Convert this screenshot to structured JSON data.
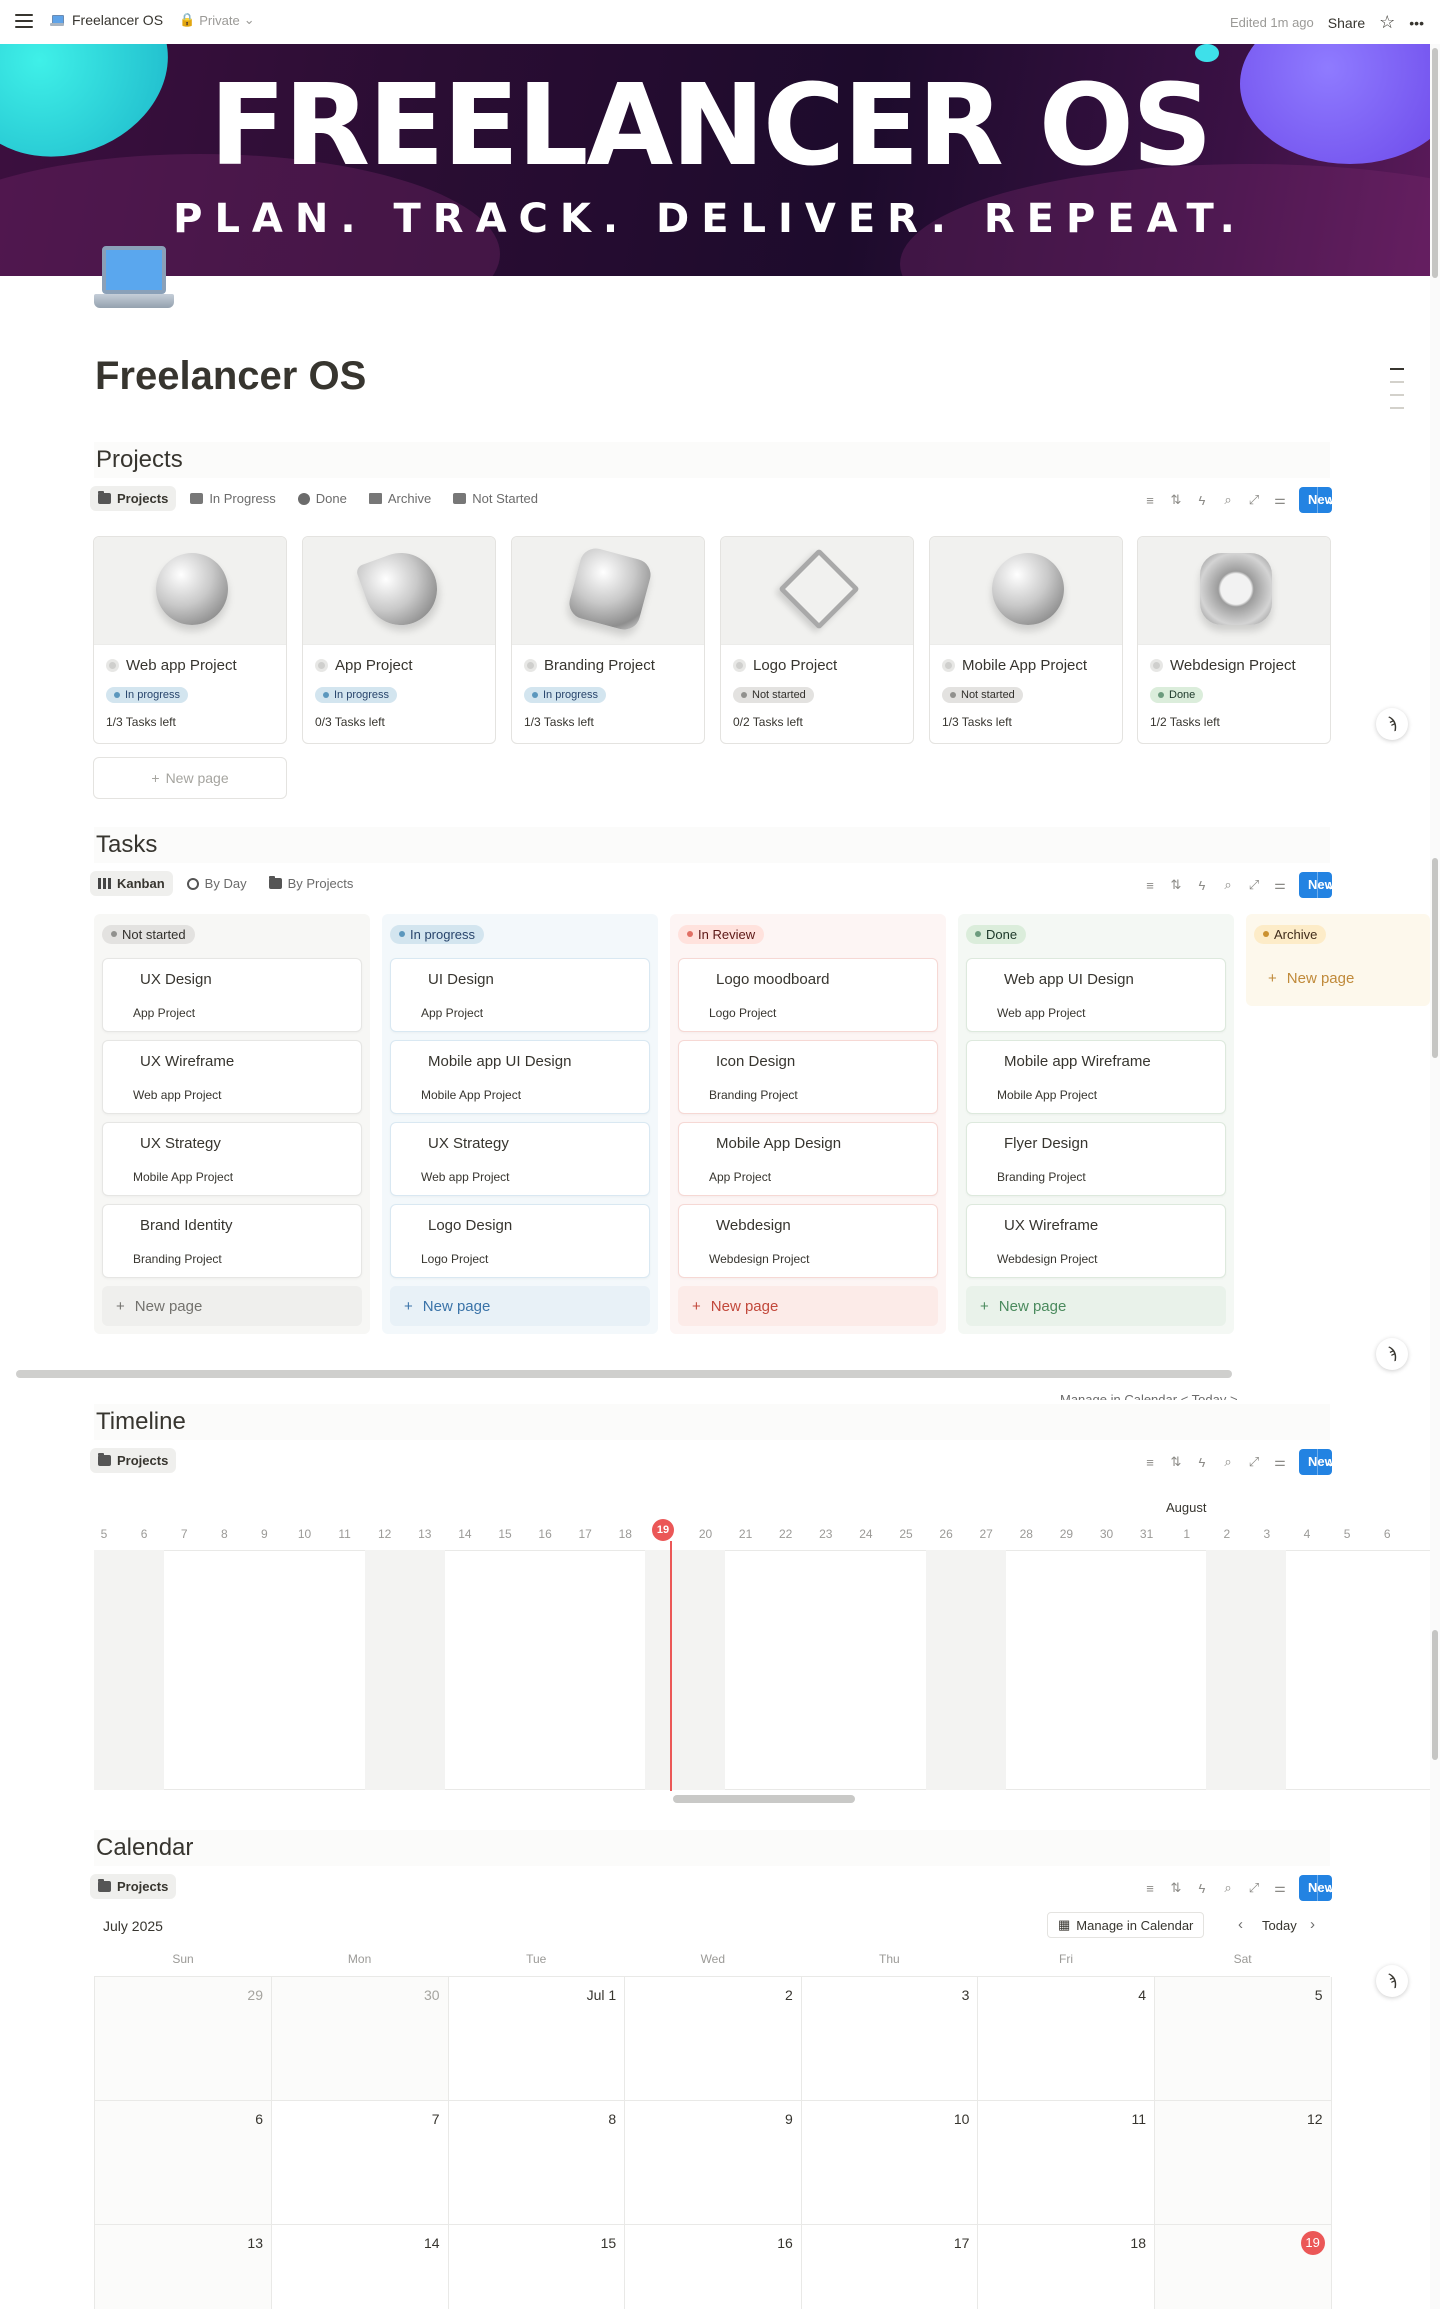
{
  "topbar": {
    "page_name": "Freelancer OS",
    "privacy": "Private",
    "edited": "Edited 1m ago",
    "share": "Share",
    "more": "•••"
  },
  "banner": {
    "title": "FREELANCER OS",
    "tagline": "PLAN. TRACK. DELIVER. REPEAT."
  },
  "page": {
    "title": "Freelancer OS"
  },
  "common": {
    "new": "New",
    "new_page": "New page",
    "plus": "+"
  },
  "projects": {
    "heading": "Projects",
    "tabs": [
      "Projects",
      "In Progress",
      "Done",
      "Archive",
      "Not Started"
    ],
    "cards": [
      {
        "name": "Web app Project",
        "status": "In progress",
        "tasks": "1/3 Tasks left"
      },
      {
        "name": "App Project",
        "status": "In progress",
        "tasks": "0/3 Tasks left"
      },
      {
        "name": "Branding Project",
        "status": "In progress",
        "tasks": "1/3 Tasks left"
      },
      {
        "name": "Logo Project",
        "status": "Not started",
        "tasks": "0/2 Tasks left"
      },
      {
        "name": "Mobile App Project",
        "status": "Not started",
        "tasks": "1/3 Tasks left"
      },
      {
        "name": "Webdesign Project",
        "status": "Done",
        "tasks": "1/2 Tasks left"
      }
    ]
  },
  "tasks": {
    "heading": "Tasks",
    "tabs": [
      "Kanban",
      "By Day",
      "By Projects"
    ],
    "columns": [
      {
        "name": "Not started",
        "cards": [
          {
            "title": "UX Design",
            "project": "App Project"
          },
          {
            "title": "UX Wireframe",
            "project": "Web app Project"
          },
          {
            "title": "UX Strategy",
            "project": "Mobile App Project"
          },
          {
            "title": "Brand Identity",
            "project": "Branding Project"
          }
        ]
      },
      {
        "name": "In progress",
        "cards": [
          {
            "title": "UI Design",
            "project": "App Project"
          },
          {
            "title": "Mobile app UI Design",
            "project": "Mobile App Project"
          },
          {
            "title": "UX Strategy",
            "project": "Web app Project"
          },
          {
            "title": "Logo Design",
            "project": "Logo Project"
          }
        ]
      },
      {
        "name": "In Review",
        "cards": [
          {
            "title": "Logo moodboard",
            "project": "Logo Project"
          },
          {
            "title": "Icon Design",
            "project": "Branding Project"
          },
          {
            "title": "Mobile App Design",
            "project": "App Project"
          },
          {
            "title": "Webdesign",
            "project": "Webdesign Project"
          }
        ]
      },
      {
        "name": "Done",
        "cards": [
          {
            "title": "Web app UI Design",
            "project": "Web app Project"
          },
          {
            "title": "Mobile app Wireframe",
            "project": "Mobile App Project"
          },
          {
            "title": "Flyer Design",
            "project": "Branding Project"
          },
          {
            "title": "UX Wireframe",
            "project": "Webdesign Project"
          }
        ]
      },
      {
        "name": "Archive",
        "cards": []
      }
    ]
  },
  "timeline": {
    "heading": "Timeline",
    "tab": "Projects",
    "month": "August",
    "days": [
      "5",
      "6",
      "7",
      "8",
      "9",
      "10",
      "11",
      "12",
      "13",
      "14",
      "15",
      "16",
      "17",
      "18",
      "19",
      "20",
      "21",
      "22",
      "23",
      "24",
      "25",
      "26",
      "27",
      "28",
      "29",
      "30",
      "31",
      "1",
      "2",
      "3",
      "4",
      "5",
      "6"
    ],
    "today": "19",
    "peek": "Manage in Calendar  < Today >"
  },
  "calendar": {
    "heading": "Calendar",
    "tab": "Projects",
    "month": "July 2025",
    "manage": "Manage in Calendar",
    "today_btn": "Today",
    "dow": [
      "Sun",
      "Mon",
      "Tue",
      "Wed",
      "Thu",
      "Fri",
      "Sat"
    ],
    "rows": [
      [
        "29",
        "30",
        "Jul 1",
        "2",
        "3",
        "4",
        "5"
      ],
      [
        "6",
        "7",
        "8",
        "9",
        "10",
        "11",
        "12"
      ],
      [
        "13",
        "14",
        "15",
        "16",
        "17",
        "18",
        "19"
      ]
    ],
    "today": "19"
  }
}
